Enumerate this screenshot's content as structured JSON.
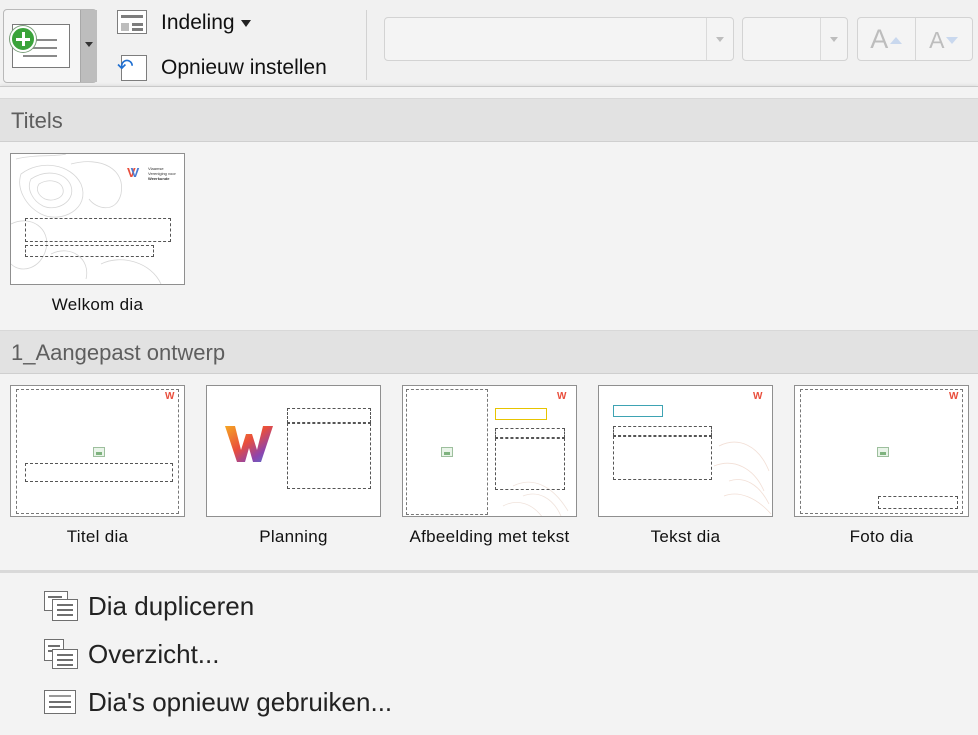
{
  "ribbon": {
    "layout_label": "Indeling",
    "reset_label": "Opnieuw instellen",
    "font_name_value": "",
    "font_size_value": "",
    "grow_font_glyph": "A",
    "shrink_font_glyph": "A"
  },
  "gallery": {
    "sections": [
      {
        "title": "Titels",
        "layouts": [
          {
            "label": "Welkom dia"
          }
        ]
      },
      {
        "title": "1_Aangepast ontwerp",
        "layouts": [
          {
            "label": "Titel dia"
          },
          {
            "label": "Planning"
          },
          {
            "label": "Afbeelding met tekst"
          },
          {
            "label": "Tekst dia"
          },
          {
            "label": "Foto dia"
          }
        ]
      }
    ],
    "logo_text": [
      "Vlaamse",
      "Vereniging voor",
      "Weerkunde"
    ],
    "logo_letter": "W",
    "commands": [
      {
        "label": "Dia dupliceren",
        "icon": "duplicate-slide-icon"
      },
      {
        "label": "Overzicht...",
        "icon": "outline-icon"
      },
      {
        "label": "Dia's opnieuw gebruiken...",
        "icon": "reuse-slides-icon"
      }
    ]
  },
  "colors": {
    "new_slide_plus": "#3aa33a",
    "reset_arrow": "#1f6fd1",
    "logo_gradient": [
      "#e94e3c",
      "#f5a623",
      "#4a7bd0",
      "#8e44ad"
    ]
  }
}
